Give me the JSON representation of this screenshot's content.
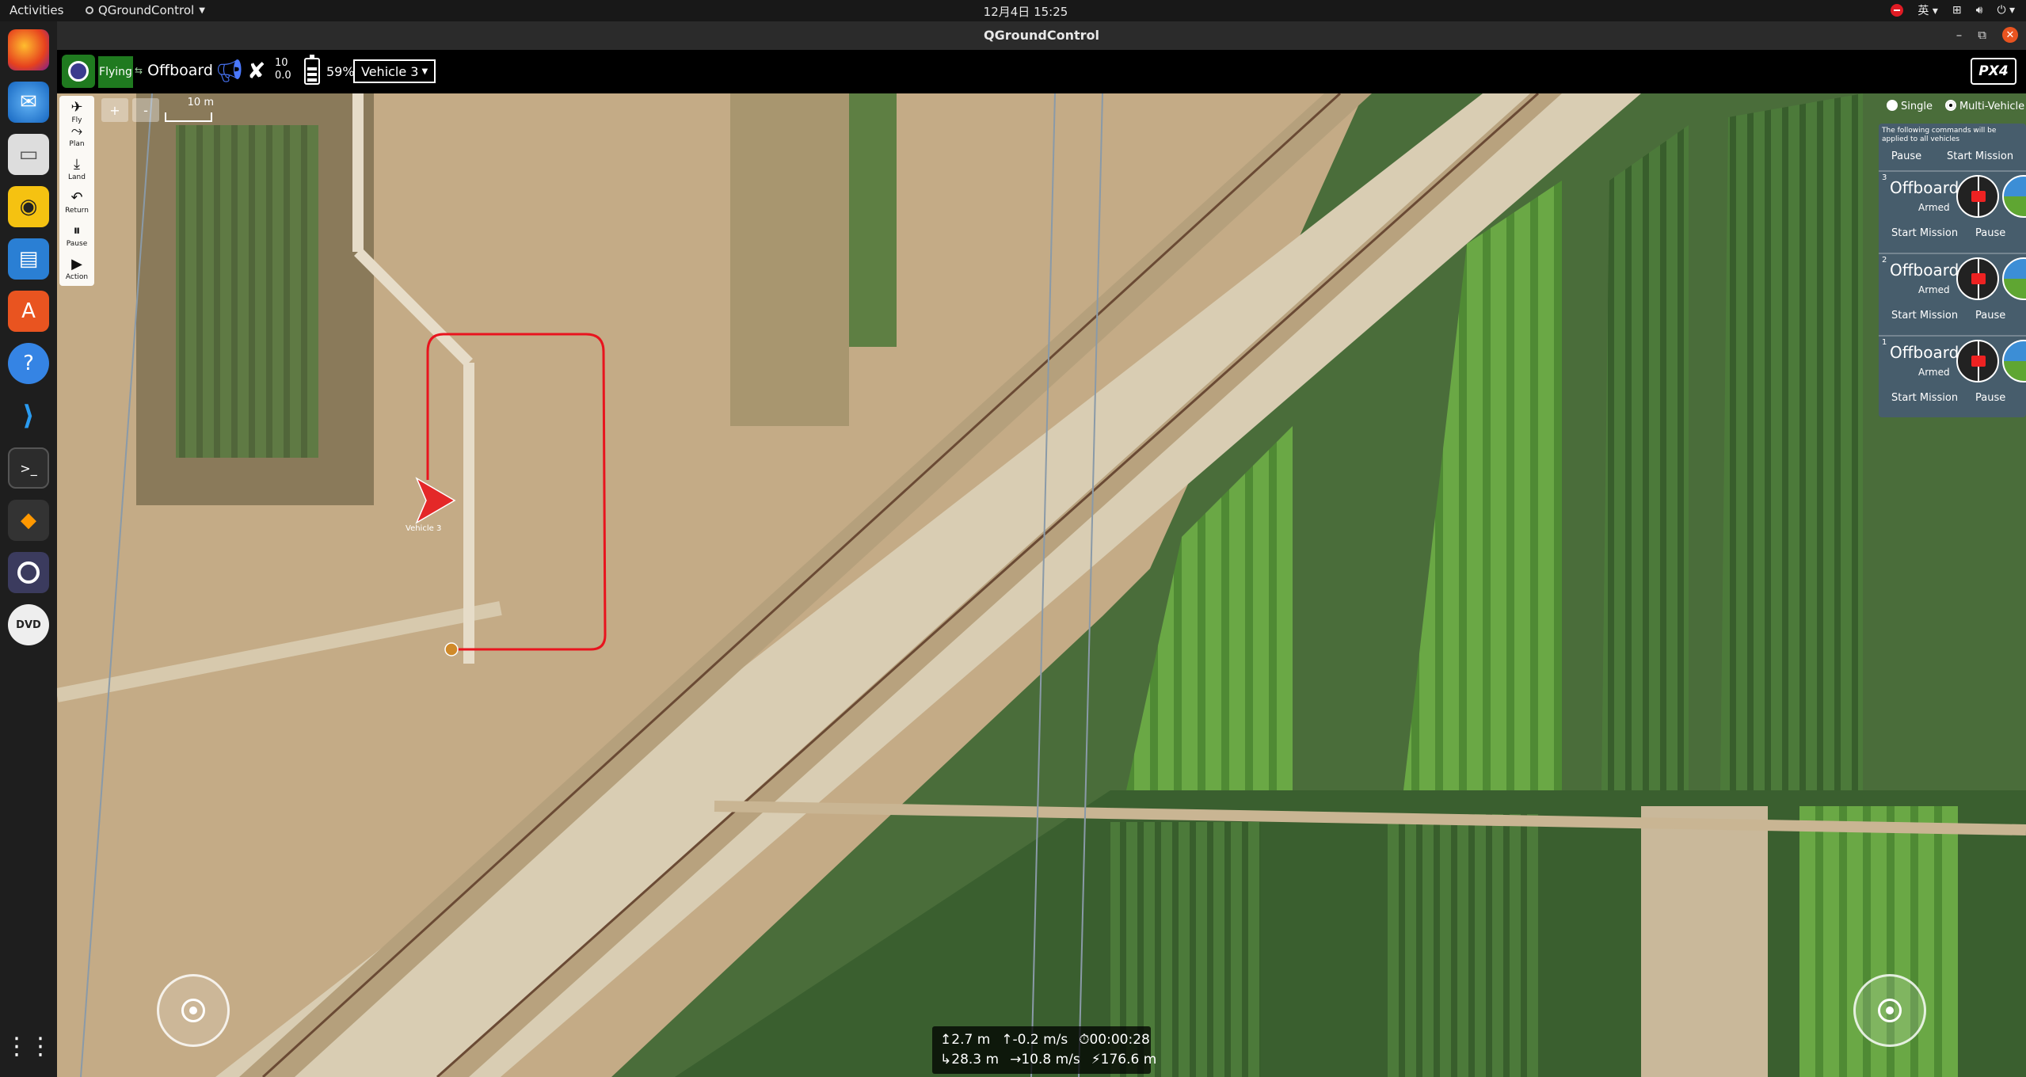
{
  "gnome": {
    "activities": "Activities",
    "app_name": "QGroundControl",
    "clock": "12月4日  15:25",
    "input_method": "英",
    "tray_icons": [
      "notification-icon",
      "input-method-icon",
      "network-icon",
      "volume-icon",
      "power-icon"
    ]
  },
  "dock": {
    "items": [
      "firefox-icon",
      "thunderbird-icon",
      "files-icon",
      "rhythmbox-icon",
      "writer-icon",
      "software-icon",
      "help-icon",
      "vscode-icon",
      "terminal-icon",
      "sublime-icon",
      "qgroundcontrol-icon",
      "dvd-icon",
      "show-apps-icon"
    ]
  },
  "window": {
    "title": "QGroundControl"
  },
  "toolbar": {
    "flight_state": "Flying",
    "flight_mode": "Offboard",
    "gps_sats": "10",
    "gps_hdop": "0.0",
    "battery_pct": "59%",
    "battery_level": 0.59,
    "vehicle_select": "Vehicle 3",
    "brand": "PX4"
  },
  "fly_tools": [
    {
      "label": "Fly",
      "icon": "plane-icon"
    },
    {
      "label": "Plan",
      "icon": "route-icon"
    },
    {
      "label": "Land",
      "icon": "land-icon"
    },
    {
      "label": "Return",
      "icon": "return-icon"
    },
    {
      "label": "Pause",
      "icon": "pause-icon"
    },
    {
      "label": "Action",
      "icon": "play-icon"
    }
  ],
  "map": {
    "zoom_in": "+",
    "zoom_out": "-",
    "scale": "10 m",
    "vehicle_label": "Vehicle 3",
    "track_color": "#e8141e"
  },
  "multi_vehicle": {
    "single_label": "Single",
    "multi_label": "Multi-Vehicle",
    "selected": "Multi-Vehicle",
    "note": "The following commands will be applied to all vehicles",
    "pause_label": "Pause",
    "start_label": "Start Mission",
    "vehicles": [
      {
        "id": "3",
        "mode": "Offboard",
        "status": "Armed",
        "start": "Start Mission",
        "pause": "Pause"
      },
      {
        "id": "2",
        "mode": "Offboard",
        "status": "Armed",
        "start": "Start Mission",
        "pause": "Pause"
      },
      {
        "id": "1",
        "mode": "Offboard",
        "status": "Armed",
        "start": "Start Mission",
        "pause": "Pause"
      }
    ]
  },
  "telemetry": {
    "altitude": "2.7 m",
    "vertical_speed": "-0.2 m/s",
    "flight_time": "00:00:28",
    "distance": "28.3 m",
    "ground_speed": "10.8 m/s",
    "distance_to_home": "176.6 m"
  }
}
